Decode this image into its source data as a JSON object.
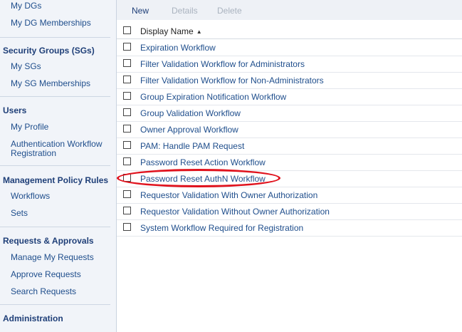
{
  "sidebar": {
    "groups": [
      {
        "title": "",
        "items": [
          "My DGs",
          "My DG Memberships"
        ]
      },
      {
        "title": "Security Groups (SGs)",
        "items": [
          "My SGs",
          "My SG Memberships"
        ]
      },
      {
        "title": "Users",
        "items": [
          "My Profile",
          "Authentication Workflow Registration"
        ]
      },
      {
        "title": "Management Policy Rules",
        "items": [
          "Workflows",
          "Sets"
        ]
      },
      {
        "title": "Requests & Approvals",
        "items": [
          "Manage My Requests",
          "Approve Requests",
          "Search Requests"
        ]
      },
      {
        "title": "Administration",
        "items": []
      }
    ]
  },
  "toolbar": {
    "new_label": "New",
    "details_label": "Details",
    "delete_label": "Delete"
  },
  "list": {
    "header": "Display Name",
    "rows": [
      "Expiration Workflow",
      "Filter Validation Workflow for Administrators",
      "Filter Validation Workflow for Non-Administrators",
      "Group Expiration Notification Workflow",
      "Group Validation Workflow",
      "Owner Approval Workflow",
      "PAM: Handle PAM Request",
      "Password Reset Action Workflow",
      "Password Reset AuthN Workflow",
      "Requestor Validation With Owner Authorization",
      "Requestor Validation Without Owner Authorization",
      "System Workflow Required for Registration"
    ]
  },
  "icons": {
    "sort": "sort-ascending-icon"
  },
  "colors": {
    "link": "#1f4e8c",
    "group_title": "#1f3f78",
    "highlight": "#e0121d",
    "sidebar_bg": "#f1f4f9"
  }
}
